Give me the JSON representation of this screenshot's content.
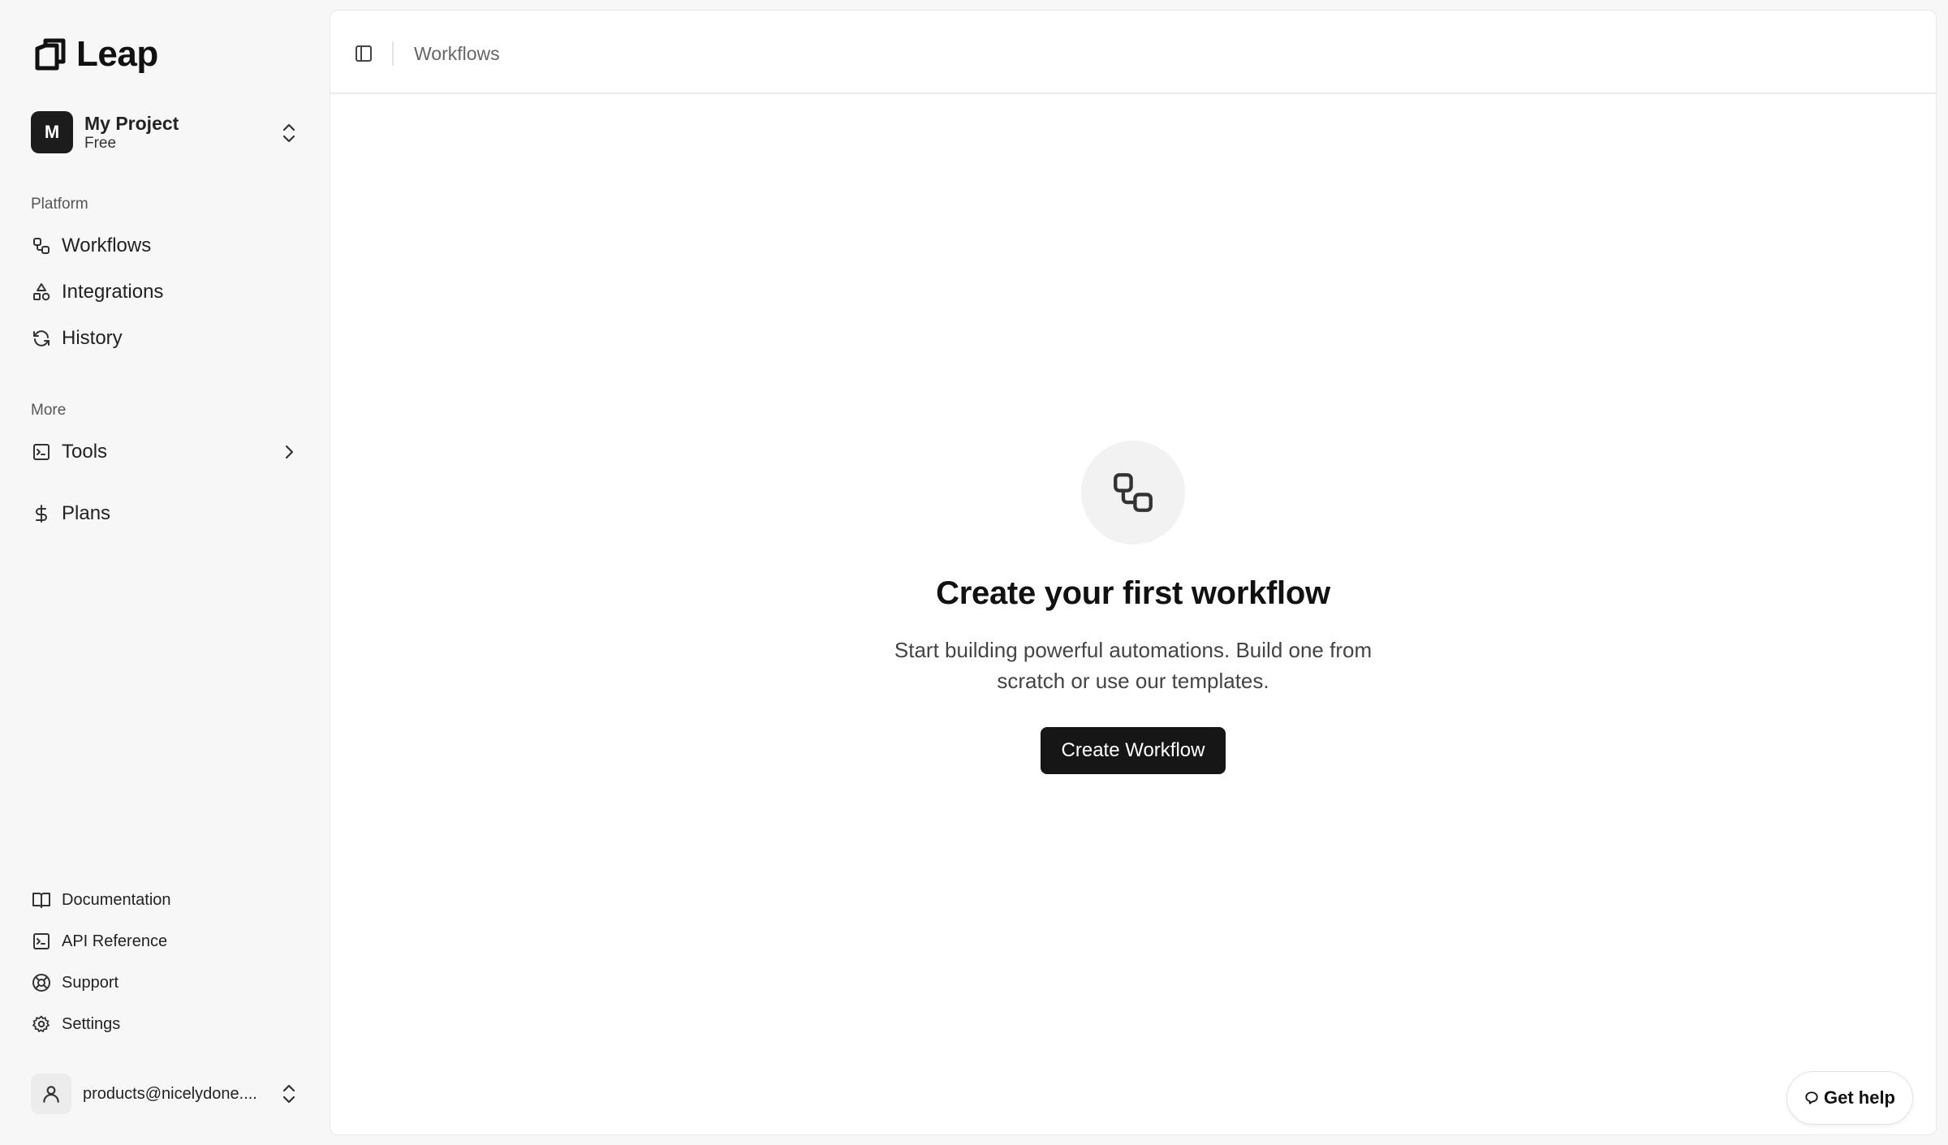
{
  "app": {
    "name": "Leap",
    "logo_icon": "leap-logo-icon"
  },
  "project": {
    "avatar_letter": "M",
    "name": "My Project",
    "plan": "Free",
    "switch_icon": "chevrons-up-down-icon"
  },
  "sidebar": {
    "platform_label": "Platform",
    "platform_items": [
      {
        "label": "Workflows",
        "icon": "workflow-icon"
      },
      {
        "label": "Integrations",
        "icon": "shapes-icon"
      },
      {
        "label": "History",
        "icon": "refresh-icon"
      }
    ],
    "more_label": "More",
    "more_items": [
      {
        "label": "Tools",
        "icon": "terminal-icon",
        "has_submenu": true
      },
      {
        "label": "Plans",
        "icon": "dollar-icon"
      }
    ],
    "footer_items": [
      {
        "label": "Documentation",
        "icon": "book-icon"
      },
      {
        "label": "API Reference",
        "icon": "terminal-icon"
      },
      {
        "label": "Support",
        "icon": "life-buoy-icon"
      },
      {
        "label": "Settings",
        "icon": "gear-icon"
      }
    ],
    "user": {
      "email": "products@nicelydone....",
      "icon": "user-icon"
    }
  },
  "topbar": {
    "breadcrumb": "Workflows",
    "toggle_icon": "panel-left-icon"
  },
  "empty_state": {
    "icon": "workflow-icon",
    "title": "Create your first workflow",
    "description": "Start building powerful automations. Build one from scratch or use our templates.",
    "button_label": "Create Workflow"
  },
  "help": {
    "label": "Get help",
    "icon": "chat-bubble-icon"
  }
}
